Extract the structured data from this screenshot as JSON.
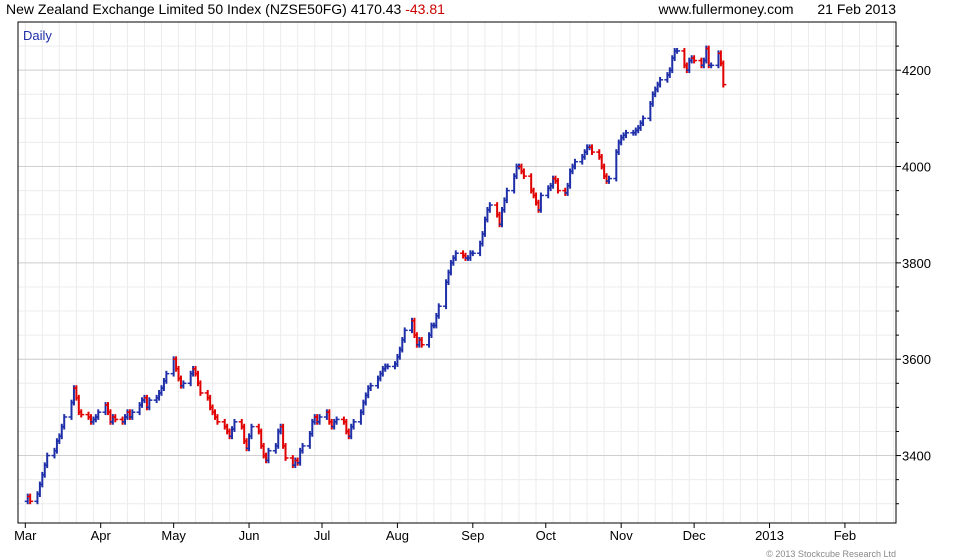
{
  "header": {
    "title": "New Zealand Exchange Limited 50 Index (NZSE50FG)",
    "last_value": "4170.43",
    "change": "-43.81",
    "website": "www.fullermoney.com",
    "date": "21 Feb 2013",
    "change_color": "#cc0000"
  },
  "footer": {
    "copyright": "© 2013 Stockcube Research Ltd"
  },
  "chart_data": {
    "type": "bar",
    "style": "ohlc",
    "period_label": "Daily",
    "grid": true,
    "up_color": "#1f2fa8",
    "down_color": "#e00000",
    "ylim": [
      3260,
      4300
    ],
    "y_ticks": [
      3400,
      3600,
      3800,
      4000,
      4200
    ],
    "x_months": [
      {
        "label": "Mar",
        "day": 0
      },
      {
        "label": "Apr",
        "day": 31
      },
      {
        "label": "May",
        "day": 61
      },
      {
        "label": "Jun",
        "day": 92
      },
      {
        "label": "Jul",
        "day": 122
      },
      {
        "label": "Aug",
        "day": 153
      },
      {
        "label": "Sep",
        "day": 184
      },
      {
        "label": "Oct",
        "day": 214
      },
      {
        "label": "Nov",
        "day": 245
      },
      {
        "label": "Dec",
        "day": 275
      },
      {
        "label": "2013",
        "day": 306
      },
      {
        "label": "Feb",
        "day": 337
      }
    ],
    "x_range": [
      -3,
      358
    ],
    "series": [
      {
        "values": [
          [
            1,
            3315
          ],
          [
            2,
            3305
          ],
          [
            5,
            3320
          ],
          [
            6,
            3340
          ],
          [
            7,
            3360
          ],
          [
            8,
            3380
          ],
          [
            9,
            3400
          ],
          [
            12,
            3410
          ],
          [
            13,
            3430
          ],
          [
            14,
            3440
          ],
          [
            15,
            3460
          ],
          [
            16,
            3480
          ],
          [
            19,
            3510
          ],
          [
            20,
            3540
          ],
          [
            21,
            3520
          ],
          [
            22,
            3490
          ],
          [
            23,
            3485
          ],
          [
            26,
            3480
          ],
          [
            27,
            3470
          ],
          [
            28,
            3475
          ],
          [
            29,
            3480
          ],
          [
            30,
            3490
          ],
          [
            33,
            3505
          ],
          [
            34,
            3490
          ],
          [
            35,
            3470
          ],
          [
            36,
            3480
          ],
          [
            37,
            3475
          ],
          [
            40,
            3470
          ],
          [
            41,
            3480
          ],
          [
            42,
            3490
          ],
          [
            43,
            3480
          ],
          [
            44,
            3490
          ],
          [
            47,
            3505
          ],
          [
            48,
            3515
          ],
          [
            49,
            3520
          ],
          [
            50,
            3500
          ],
          [
            51,
            3515
          ],
          [
            54,
            3520
          ],
          [
            55,
            3530
          ],
          [
            56,
            3540
          ],
          [
            57,
            3555
          ],
          [
            58,
            3570
          ],
          [
            61,
            3600
          ],
          [
            62,
            3580
          ],
          [
            63,
            3560
          ],
          [
            64,
            3545
          ],
          [
            65,
            3550
          ],
          [
            68,
            3570
          ],
          [
            69,
            3580
          ],
          [
            70,
            3570
          ],
          [
            71,
            3550
          ],
          [
            72,
            3530
          ],
          [
            75,
            3520
          ],
          [
            76,
            3500
          ],
          [
            77,
            3490
          ],
          [
            78,
            3480
          ],
          [
            79,
            3470
          ],
          [
            82,
            3460
          ],
          [
            83,
            3450
          ],
          [
            84,
            3440
          ],
          [
            85,
            3455
          ],
          [
            86,
            3470
          ],
          [
            89,
            3460
          ],
          [
            90,
            3430
          ],
          [
            91,
            3415
          ],
          [
            92,
            3440
          ],
          [
            93,
            3460
          ],
          [
            96,
            3450
          ],
          [
            97,
            3420
          ],
          [
            98,
            3400
          ],
          [
            99,
            3390
          ],
          [
            100,
            3410
          ],
          [
            103,
            3420
          ],
          [
            104,
            3450
          ],
          [
            105,
            3460
          ],
          [
            106,
            3420
          ],
          [
            107,
            3395
          ],
          [
            110,
            3380
          ],
          [
            111,
            3390
          ],
          [
            112,
            3385
          ],
          [
            113,
            3410
          ],
          [
            114,
            3420
          ],
          [
            117,
            3445
          ],
          [
            118,
            3470
          ],
          [
            119,
            3480
          ],
          [
            120,
            3470
          ],
          [
            121,
            3480
          ],
          [
            124,
            3490
          ],
          [
            125,
            3470
          ],
          [
            126,
            3460
          ],
          [
            127,
            3470
          ],
          [
            128,
            3475
          ],
          [
            131,
            3470
          ],
          [
            132,
            3450
          ],
          [
            133,
            3440
          ],
          [
            134,
            3460
          ],
          [
            135,
            3470
          ],
          [
            138,
            3490
          ],
          [
            139,
            3510
          ],
          [
            140,
            3525
          ],
          [
            141,
            3540
          ],
          [
            142,
            3545
          ],
          [
            145,
            3560
          ],
          [
            146,
            3570
          ],
          [
            147,
            3580
          ],
          [
            148,
            3585
          ],
          [
            149,
            3585
          ],
          [
            152,
            3590
          ],
          [
            153,
            3605
          ],
          [
            154,
            3620
          ],
          [
            155,
            3640
          ],
          [
            156,
            3660
          ],
          [
            159,
            3680
          ],
          [
            160,
            3650
          ],
          [
            161,
            3630
          ],
          [
            162,
            3640
          ],
          [
            163,
            3630
          ],
          [
            166,
            3650
          ],
          [
            167,
            3670
          ],
          [
            168,
            3670
          ],
          [
            169,
            3690
          ],
          [
            170,
            3710
          ],
          [
            173,
            3760
          ],
          [
            174,
            3780
          ],
          [
            175,
            3800
          ],
          [
            176,
            3810
          ],
          [
            177,
            3820
          ],
          [
            180,
            3815
          ],
          [
            181,
            3810
          ],
          [
            182,
            3810
          ],
          [
            183,
            3820
          ],
          [
            184,
            3820
          ],
          [
            187,
            3840
          ],
          [
            188,
            3860
          ],
          [
            189,
            3890
          ],
          [
            190,
            3910
          ],
          [
            191,
            3920
          ],
          [
            194,
            3900
          ],
          [
            195,
            3880
          ],
          [
            196,
            3910
          ],
          [
            197,
            3930
          ],
          [
            198,
            3950
          ],
          [
            201,
            3980
          ],
          [
            202,
            4000
          ],
          [
            203,
            4000
          ],
          [
            204,
            3990
          ],
          [
            205,
            3980
          ],
          [
            208,
            3950
          ],
          [
            209,
            3940
          ],
          [
            210,
            3925
          ],
          [
            211,
            3910
          ],
          [
            212,
            3940
          ],
          [
            215,
            3955
          ],
          [
            216,
            3960
          ],
          [
            217,
            3975
          ],
          [
            218,
            3970
          ],
          [
            219,
            3950
          ],
          [
            222,
            3945
          ],
          [
            223,
            3960
          ],
          [
            224,
            3990
          ],
          [
            225,
            4000
          ],
          [
            226,
            4010
          ],
          [
            229,
            4020
          ],
          [
            230,
            4030
          ],
          [
            231,
            4040
          ],
          [
            232,
            4040
          ],
          [
            233,
            4030
          ],
          [
            236,
            4020
          ],
          [
            237,
            4000
          ],
          [
            238,
            3980
          ],
          [
            239,
            3970
          ],
          [
            240,
            3975
          ],
          [
            243,
            4030
          ],
          [
            244,
            4050
          ],
          [
            245,
            4060
          ],
          [
            246,
            4065
          ],
          [
            247,
            4070
          ],
          [
            250,
            4070
          ],
          [
            251,
            4075
          ],
          [
            252,
            4080
          ],
          [
            253,
            4090
          ],
          [
            254,
            4100
          ],
          [
            257,
            4130
          ],
          [
            258,
            4150
          ],
          [
            259,
            4160
          ],
          [
            260,
            4170
          ],
          [
            261,
            4180
          ],
          [
            264,
            4190
          ],
          [
            265,
            4200
          ],
          [
            266,
            4225
          ],
          [
            267,
            4240
          ],
          [
            268,
            4240
          ],
          [
            271,
            4210
          ],
          [
            272,
            4200
          ],
          [
            273,
            4220
          ],
          [
            274,
            4225
          ],
          [
            275,
            4220
          ],
          [
            278,
            4210
          ],
          [
            279,
            4220
          ],
          [
            280,
            4245
          ],
          [
            281,
            4210
          ],
          [
            282,
            4210
          ],
          [
            285,
            4235
          ],
          [
            286,
            4214
          ],
          [
            287,
            4170
          ]
        ]
      }
    ]
  }
}
